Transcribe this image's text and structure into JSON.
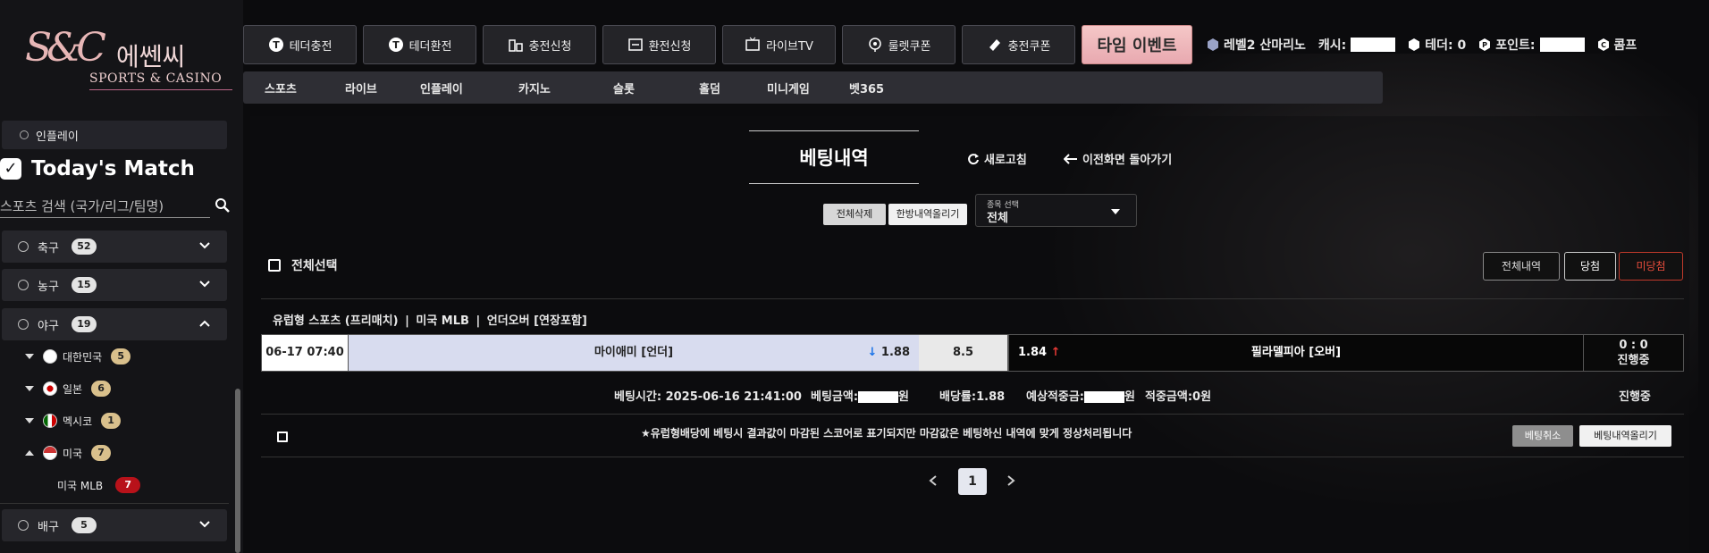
{
  "logo": {
    "mark": "S&C",
    "ko": "에쎈씨",
    "en": "SPORTS & CASINO"
  },
  "sidebar": {
    "inplay_label": "인플레이",
    "today_title": "Today's Match",
    "search_placeholder": "스포츠 검색 (국가/리그/팀명)",
    "sports": [
      {
        "label": "축구",
        "count": "52"
      },
      {
        "label": "농구",
        "count": "15"
      },
      {
        "label": "야구",
        "count": "19"
      },
      {
        "label": "배구",
        "count": "5"
      }
    ],
    "countries": [
      {
        "label": "대한민국",
        "count": "5"
      },
      {
        "label": "일본",
        "count": "6"
      },
      {
        "label": "멕시코",
        "count": "1"
      },
      {
        "label": "미국",
        "count": "7"
      }
    ],
    "league": {
      "label": "미국 MLB",
      "count": "7"
    }
  },
  "topnav": {
    "buttons": [
      "테더충전",
      "테더환전",
      "충전신청",
      "환전신청",
      "라이브TV",
      "룰렛쿠폰",
      "충전쿠폰"
    ],
    "event_label": "타임 이벤트"
  },
  "userbar": {
    "level": "레벨2 산마리노",
    "cash_label": "캐시:",
    "tether_label": "테더: 0",
    "point_label": "포인트:",
    "comp_label": "콤프"
  },
  "subnav": [
    "스포츠",
    "라이브",
    "인플레이",
    "카지노",
    "슬롯",
    "홀덤",
    "미니게임",
    "벳365"
  ],
  "main": {
    "title": "베팅내역",
    "refresh_label": "새로고침",
    "back_label": "이전화면 돌아가기",
    "delete_all": "전체삭제",
    "upload_all": "한방내역올리기",
    "select_label": "종목 선택",
    "select_value": "전체",
    "select_all": "전체선택",
    "filters": [
      "전체내역",
      "당첨",
      "미당첨"
    ],
    "bet": {
      "header_a": "유럽형 스포츠 (프리매치)",
      "header_b": "미국 MLB",
      "header_c": "언더오버 [연장포함]",
      "date": "06-17 07:40",
      "home": "마이애미 [언더]",
      "home_odds": "1.88",
      "line": "8.5",
      "away_odds": "1.84",
      "away": "필라델피아 [오버]",
      "score": "0 : 0",
      "status": "진행중",
      "time_label": "베팅시간: 2025-06-16 21:41:00",
      "amount_label": "베팅금액:",
      "amount_suffix": "원",
      "odds_label": "배당률:1.88",
      "expected_label": "예상적중금:",
      "expected_suffix": "원",
      "hit_label": "적중금액:0원",
      "state": "진행중",
      "notice": "★유럽형배당에 베팅시 결과값이 마감된 스코어로 표기되지만 마감값은 베팅하신 내역에 맞게 정상처리됩니다",
      "cancel_label": "베팅취소",
      "upload_label": "베팅내역올리기"
    },
    "page": "1"
  }
}
